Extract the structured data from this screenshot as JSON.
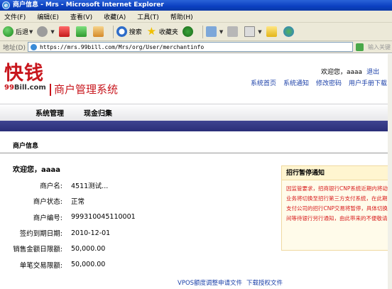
{
  "window": {
    "title": "商户信息 - Mrs - Microsoft Internet Explorer"
  },
  "menu": [
    "文件(F)",
    "编辑(E)",
    "查看(V)",
    "收藏(A)",
    "工具(T)",
    "帮助(H)"
  ],
  "toolbar": {
    "back": "后退",
    "search": "搜索",
    "favorites": "收藏夹"
  },
  "address": {
    "label": "地址(D)",
    "url": "https://mrs.99bill.com/Mrs/org/User/merchantinfo",
    "hint": "输入关键"
  },
  "header": {
    "logo_main": "快钱",
    "logo_99": "99",
    "logo_bill": "Bill",
    "logo_com": ".com",
    "system_title": "商户管理系统",
    "welcome": "欢迎您，aaaa",
    "logout": "退出",
    "links": [
      "系统首页",
      "系统通知",
      "修改密码",
      "用户手册下载"
    ]
  },
  "nav": [
    "系统管理",
    "现金归集"
  ],
  "section": {
    "title": "商户信息"
  },
  "merchant": {
    "welcome": "欢迎您，aaaa",
    "fields": [
      {
        "label": "商户名:",
        "value": "4511测试..."
      },
      {
        "label": "商户状态:",
        "value": "正常"
      },
      {
        "label": "商户编号:",
        "value": "999310045110001"
      },
      {
        "label": "签约到期日期:",
        "value": "2010-12-01"
      },
      {
        "label": "销售金额日限额:",
        "value": "50,000.00"
      },
      {
        "label": "单笔交易限额:",
        "value": "50,000.00"
      }
    ]
  },
  "notice": {
    "title": "招行暂停通知",
    "lines": [
      "因监管要求，招商银行CNP系统近期内将动",
      "业务将切换至招行第三方支付系统，在此期",
      "支付公司的招行CNP交易将暂停，具体切换",
      "间等待银行另行通知，由此带来的不便敬请"
    ]
  },
  "footer": {
    "link1": "VPOS额度调整申请文件",
    "link2": "下载授权文件"
  }
}
